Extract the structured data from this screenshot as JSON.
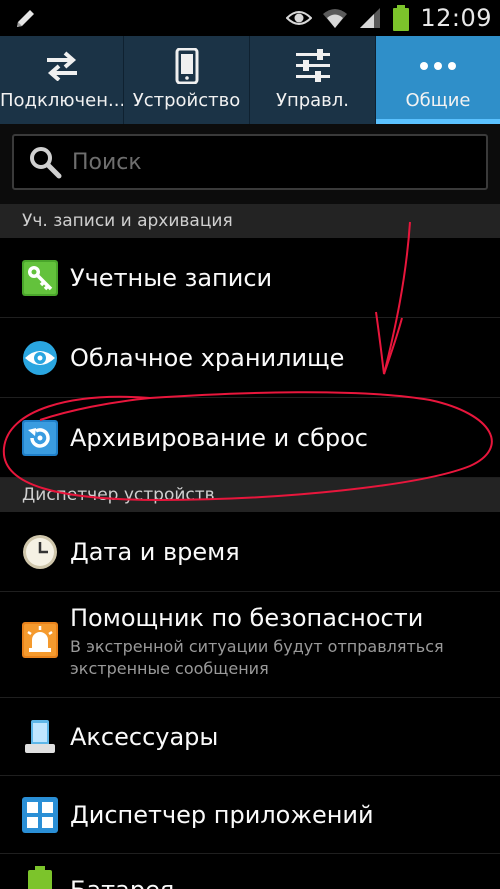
{
  "status_bar": {
    "time": "12:09",
    "icons": [
      "pencil-icon",
      "eye-icon",
      "wifi-icon",
      "signal-icon",
      "battery-icon"
    ],
    "battery_color": "#7cc42b"
  },
  "tabs": [
    {
      "label": "Подключен...",
      "icon": "swap-arrows-icon",
      "active": false
    },
    {
      "label": "Устройство",
      "icon": "phone-icon",
      "active": false
    },
    {
      "label": "Управл.",
      "icon": "sliders-icon",
      "active": false
    },
    {
      "label": "Общие",
      "icon": "more-dots-icon",
      "active": true
    }
  ],
  "search": {
    "placeholder": "Поиск"
  },
  "sections": [
    {
      "header": "Уч. записи и архивация",
      "items": [
        {
          "title": "Учетные записи",
          "icon": "accounts-key-icon"
        },
        {
          "title": "Облачное хранилище",
          "icon": "cloud-eye-icon"
        },
        {
          "title": "Архивирование и сброс",
          "icon": "backup-reset-icon"
        }
      ]
    },
    {
      "header": "Диспетчер устройств",
      "items": [
        {
          "title": "Дата и время",
          "icon": "clock-icon"
        },
        {
          "title": "Помощник по безопасности",
          "subtitle": "В экстренной ситуации будут отправляться экстренные сообщения",
          "icon": "alarm-light-icon"
        },
        {
          "title": "Аксессуары",
          "icon": "accessory-dock-icon"
        },
        {
          "title": "Диспетчер приложений",
          "icon": "app-grid-icon"
        },
        {
          "title": "Батарея",
          "icon": "battery-item-icon"
        }
      ]
    }
  ],
  "colors": {
    "tab_bar": "#1b3346",
    "tab_active": "#2f8fc9",
    "annotation": "#e8163c"
  }
}
